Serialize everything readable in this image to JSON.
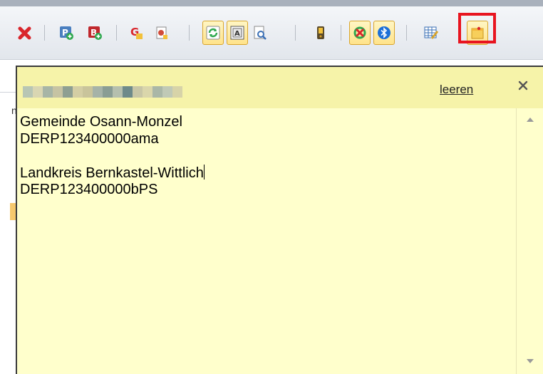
{
  "toolbar": {
    "icons": [
      {
        "name": "delete-icon",
        "color": "#d9262c"
      },
      {
        "name": "add-parcel-p-icon",
        "color": "#1e8c3a"
      },
      {
        "name": "add-parcel-b-icon",
        "color": "#c0282d"
      },
      {
        "name": "g-tool-icon",
        "color": "#e0a020"
      },
      {
        "name": "document-tool-icon",
        "color": "#d04b3a"
      },
      {
        "name": "refresh-icon",
        "color": "#2fa84f"
      },
      {
        "name": "text-frame-icon",
        "color": "#555555"
      },
      {
        "name": "preview-search-icon",
        "color": "#3a6fb5"
      },
      {
        "name": "gps-device-icon",
        "color": "#e0a020"
      },
      {
        "name": "sync-cancel-icon",
        "color": "#d9262c"
      },
      {
        "name": "bluetooth-icon",
        "color": "#1c6fd8"
      },
      {
        "name": "table-edit-icon",
        "color": "#3a6fb5"
      },
      {
        "name": "sticky-note-icon",
        "color": "#f2b53b"
      }
    ],
    "active_highlight_color": "#e8141f"
  },
  "notes_popup": {
    "clear_label": "leeren",
    "close_symbol": "✕",
    "lines": [
      "Gemeinde Osann-Monzel",
      "DERP123400000ama",
      "",
      "Landkreis Bernkastel-Wittlich",
      "DERP123400000bPS"
    ],
    "background_color": "#ffffcc",
    "header_color": "#f6f3a9"
  },
  "background": {
    "partial_text": "n"
  }
}
